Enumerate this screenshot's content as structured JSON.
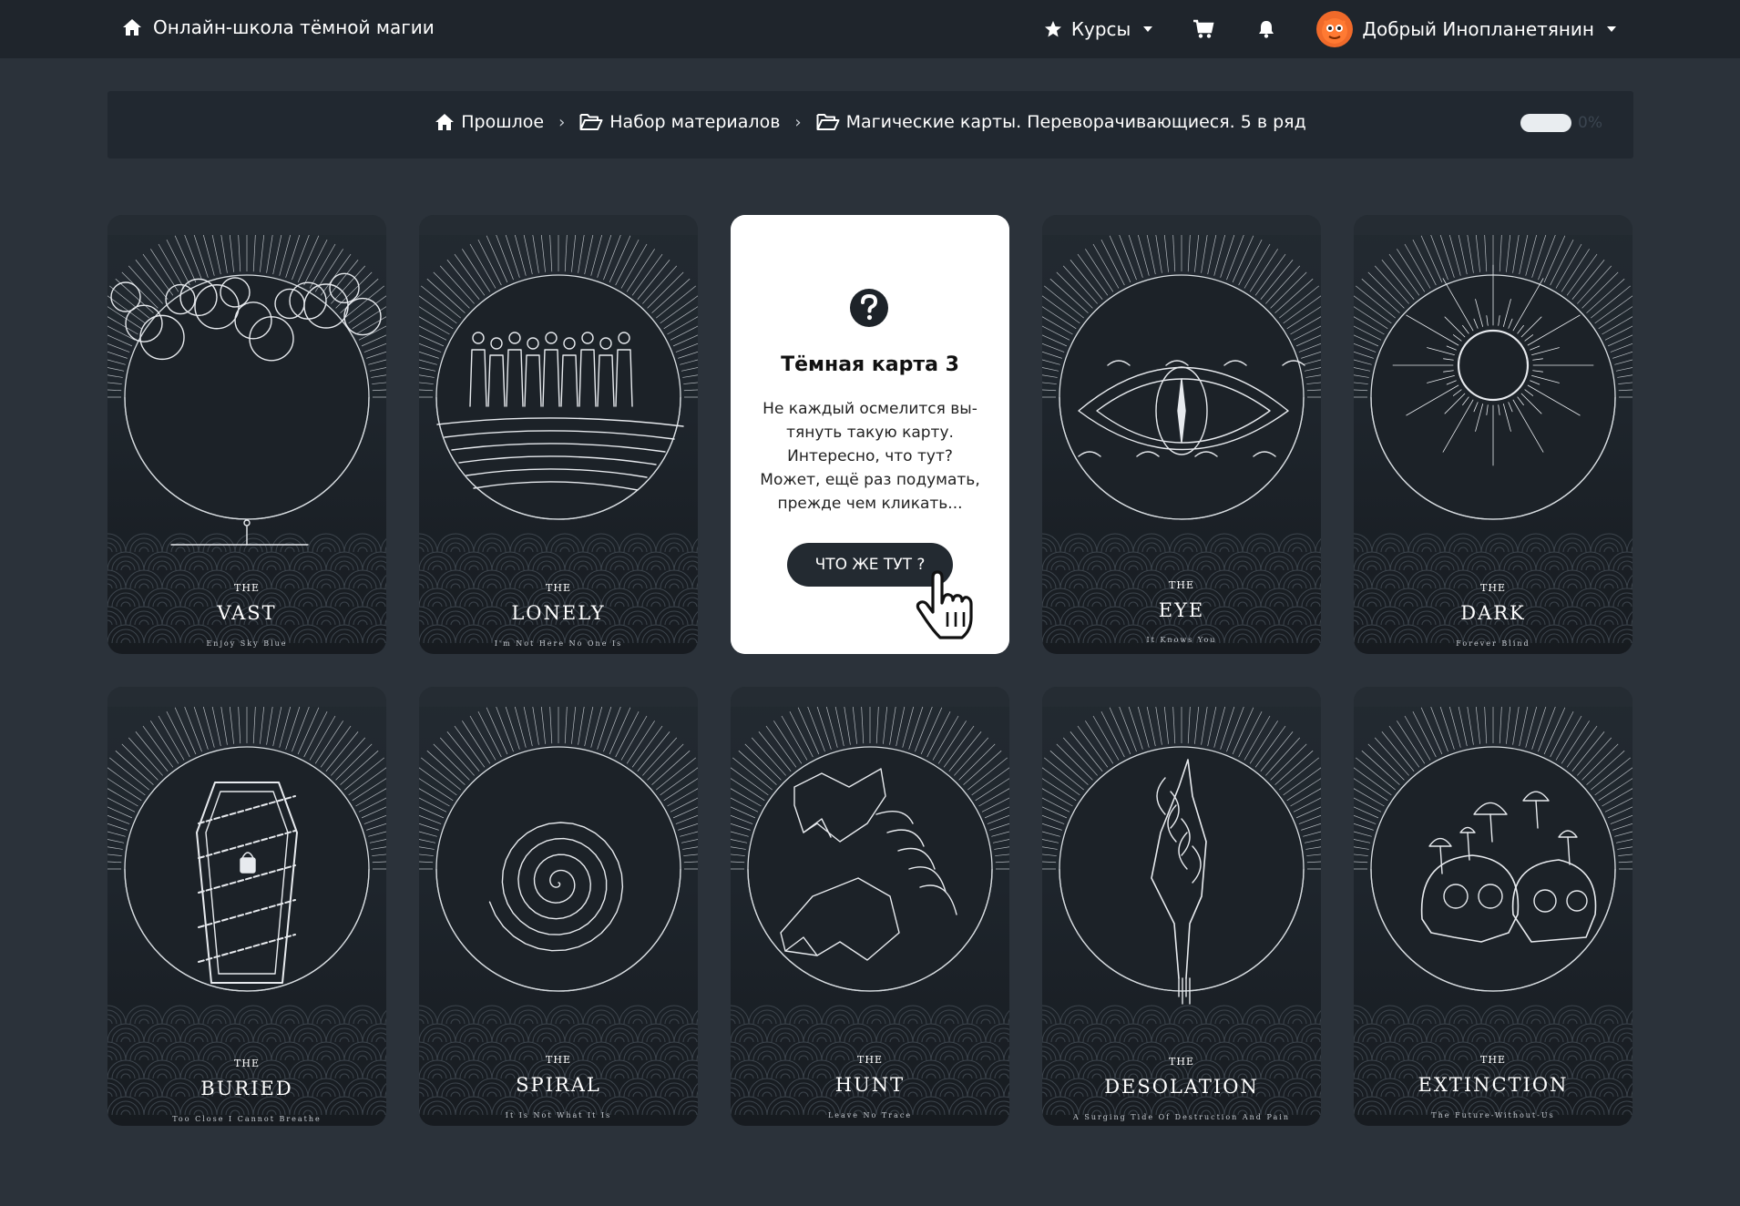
{
  "nav": {
    "brand": "Онлайн-школа тёмной магии",
    "courses": "Курсы",
    "user_name": "Добрый Инопланетянин",
    "colors": {
      "bar": "#1f252c",
      "avatar": "#f06a2a"
    }
  },
  "breadcrumb": {
    "items": [
      "Прошлое",
      "Набор материалов",
      "Магические карты. Переворачивающиеся. 5 в ряд"
    ],
    "progress_label": "0%",
    "progress_value": 0
  },
  "flipped_card": {
    "title": "Тёмная карта 3",
    "lines": [
      "Не каждый осмелится вы-",
      "тянуть такую карту.",
      "Интересно, что тут?",
      "Может, ещё раз подумать,",
      "прежде чем кликать..."
    ],
    "button": "ЧТО ЖЕ ТУТ ?",
    "icon": "question-circle-icon"
  },
  "cards": [
    {
      "the": "THE",
      "title": "VAST",
      "subtitle": "Enjoy Sky Blue",
      "art": "clouds"
    },
    {
      "the": "THE",
      "title": "LONELY",
      "subtitle": "I'm Not Here No One Is",
      "art": "crowd"
    },
    {
      "the": "",
      "title": "",
      "subtitle": "",
      "art": "flipped"
    },
    {
      "the": "THE",
      "title": "EYE",
      "subtitle": "It Knows You",
      "art": "eye"
    },
    {
      "the": "THE",
      "title": "DARK",
      "subtitle": "Forever Blind",
      "art": "sun"
    },
    {
      "the": "THE",
      "title": "BURIED",
      "subtitle": "Too Close I Cannot Breathe",
      "art": "coffin"
    },
    {
      "the": "THE",
      "title": "SPIRAL",
      "subtitle": "It Is Not What It Is",
      "art": "spiral"
    },
    {
      "the": "THE",
      "title": "HUNT",
      "subtitle": "Leave No Trace",
      "art": "wolves"
    },
    {
      "the": "THE",
      "title": "DESOLATION",
      "subtitle": "A Surging Tide Of Destruction And Pain",
      "art": "hand"
    },
    {
      "the": "THE",
      "title": "EXTINCTION",
      "subtitle": "The Future-Without-Us",
      "art": "skulls"
    }
  ]
}
